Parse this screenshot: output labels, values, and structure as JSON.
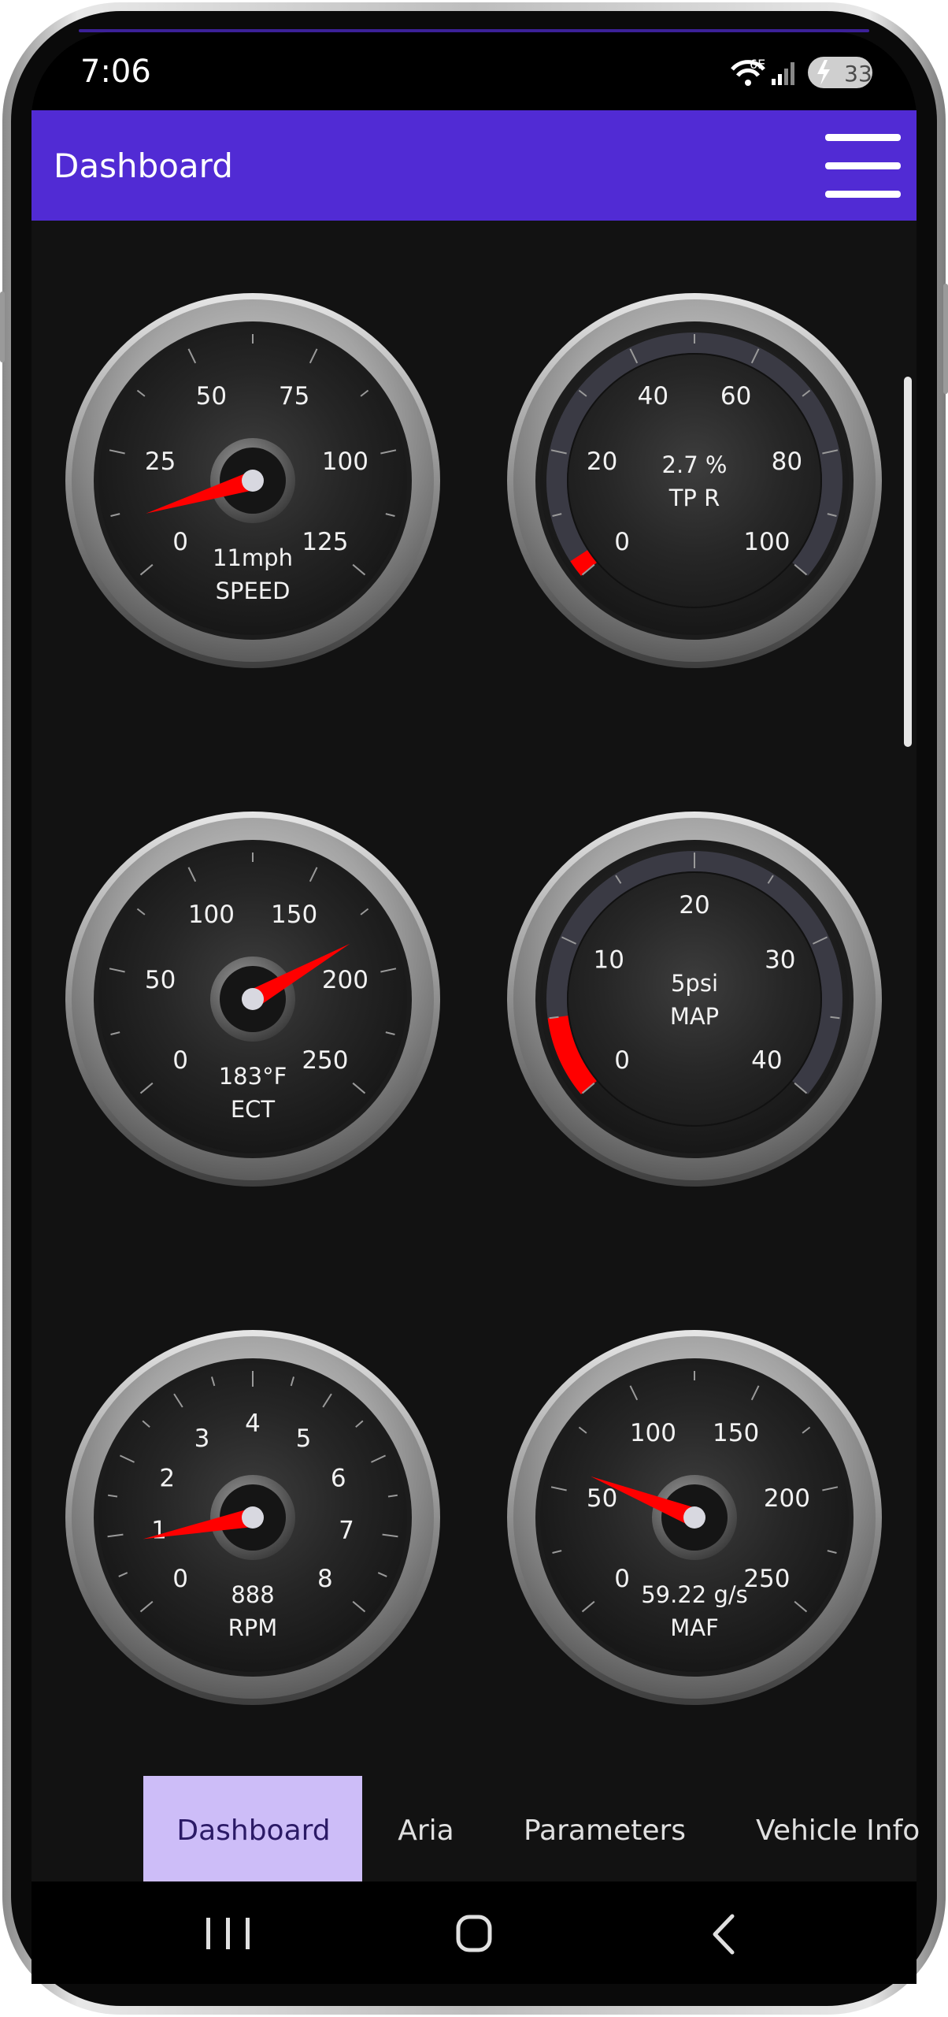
{
  "status_bar": {
    "time": "7:06",
    "network": "6E",
    "battery": "33"
  },
  "app_bar": {
    "title": "Dashboard",
    "menu_icon": "hamburger-menu-icon",
    "color": "#512BD4"
  },
  "gauges": [
    {
      "id": "speed",
      "style": "needle",
      "name": "SPEED",
      "readout": "11mph",
      "min": 0,
      "max": 125,
      "value": 11,
      "labels": [
        "0",
        "25",
        "50",
        "75",
        "100",
        "125"
      ]
    },
    {
      "id": "tpr",
      "style": "arc",
      "name": "TP R",
      "readout": "2.7 %",
      "min": 0,
      "max": 100,
      "value": 2.7,
      "labels": [
        "0",
        "20",
        "40",
        "60",
        "80",
        "100"
      ]
    },
    {
      "id": "ect",
      "style": "needle",
      "name": "ECT",
      "readout": "183°F",
      "min": 0,
      "max": 250,
      "value": 183,
      "labels": [
        "0",
        "50",
        "100",
        "150",
        "200",
        "250"
      ]
    },
    {
      "id": "map",
      "style": "arc",
      "name": "MAP",
      "readout": "5psi",
      "min": 0,
      "max": 40,
      "value": 5,
      "labels": [
        "0",
        "10",
        "20",
        "30",
        "40"
      ]
    },
    {
      "id": "rpm",
      "style": "needle",
      "name": "RPM",
      "readout": "888",
      "min": 0,
      "max": 8,
      "value": 0.888,
      "labels": [
        "0",
        "1",
        "2",
        "3",
        "4",
        "5",
        "6",
        "7",
        "8"
      ]
    },
    {
      "id": "maf",
      "style": "needle",
      "name": "MAF",
      "readout": "59.22 g/s",
      "min": 0,
      "max": 250,
      "value": 59.22,
      "labels": [
        "0",
        "50",
        "100",
        "150",
        "200",
        "250"
      ]
    }
  ],
  "tabs": [
    {
      "label": "Dashboard",
      "selected": true
    },
    {
      "label": "Aria",
      "selected": false
    },
    {
      "label": "Parameters",
      "selected": false
    },
    {
      "label": "Vehicle Info",
      "selected": false
    }
  ],
  "nav_bar": {
    "recents_icon": "recents-icon",
    "home_icon": "home-icon",
    "back_icon": "back-icon"
  },
  "colors": {
    "accent": "#512BD4",
    "tab_selected_bg": "#CDBDF8",
    "needle": "#FF0000",
    "background": "#121212"
  }
}
